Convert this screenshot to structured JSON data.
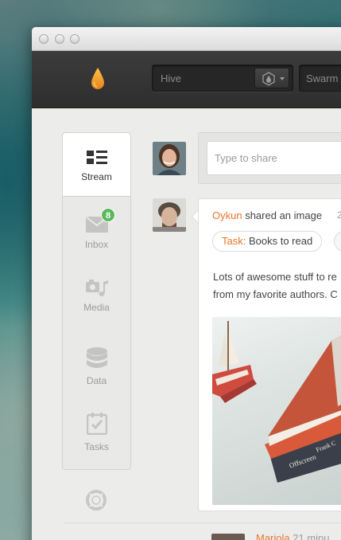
{
  "toolbar": {
    "logo_icon": "drop-icon",
    "hive_label": "Hive",
    "hive_icon": "drop-badge-icon",
    "swarm_label": "Swarm",
    "brand_color": "#f0a12a"
  },
  "sidebar": {
    "items": [
      {
        "label": "Stream",
        "icon": "list-icon",
        "active": true
      },
      {
        "label": "Inbox",
        "icon": "envelope-icon",
        "badge": "8"
      },
      {
        "label": "Media",
        "icon": "camera-music-icon"
      },
      {
        "label": "Data",
        "icon": "database-icon"
      },
      {
        "label": "Tasks",
        "icon": "checklist-icon"
      }
    ],
    "help_icon": "lifebuoy-icon"
  },
  "share": {
    "placeholder": "Type to share"
  },
  "post": {
    "author": "Oykun",
    "action": "shared an image",
    "time": "2",
    "task_prefix": "Task:",
    "task_name": "Books to read",
    "text_line1": "Lots of awesome stuff to re",
    "text_line2": "from my favorite authors. C",
    "book_title": "Offscreen",
    "book_author": "Frank C"
  },
  "next_post": {
    "author": "Mariola",
    "time": "21 minu"
  },
  "colors": {
    "accent": "#e8762b",
    "badge": "#5cb85c"
  }
}
